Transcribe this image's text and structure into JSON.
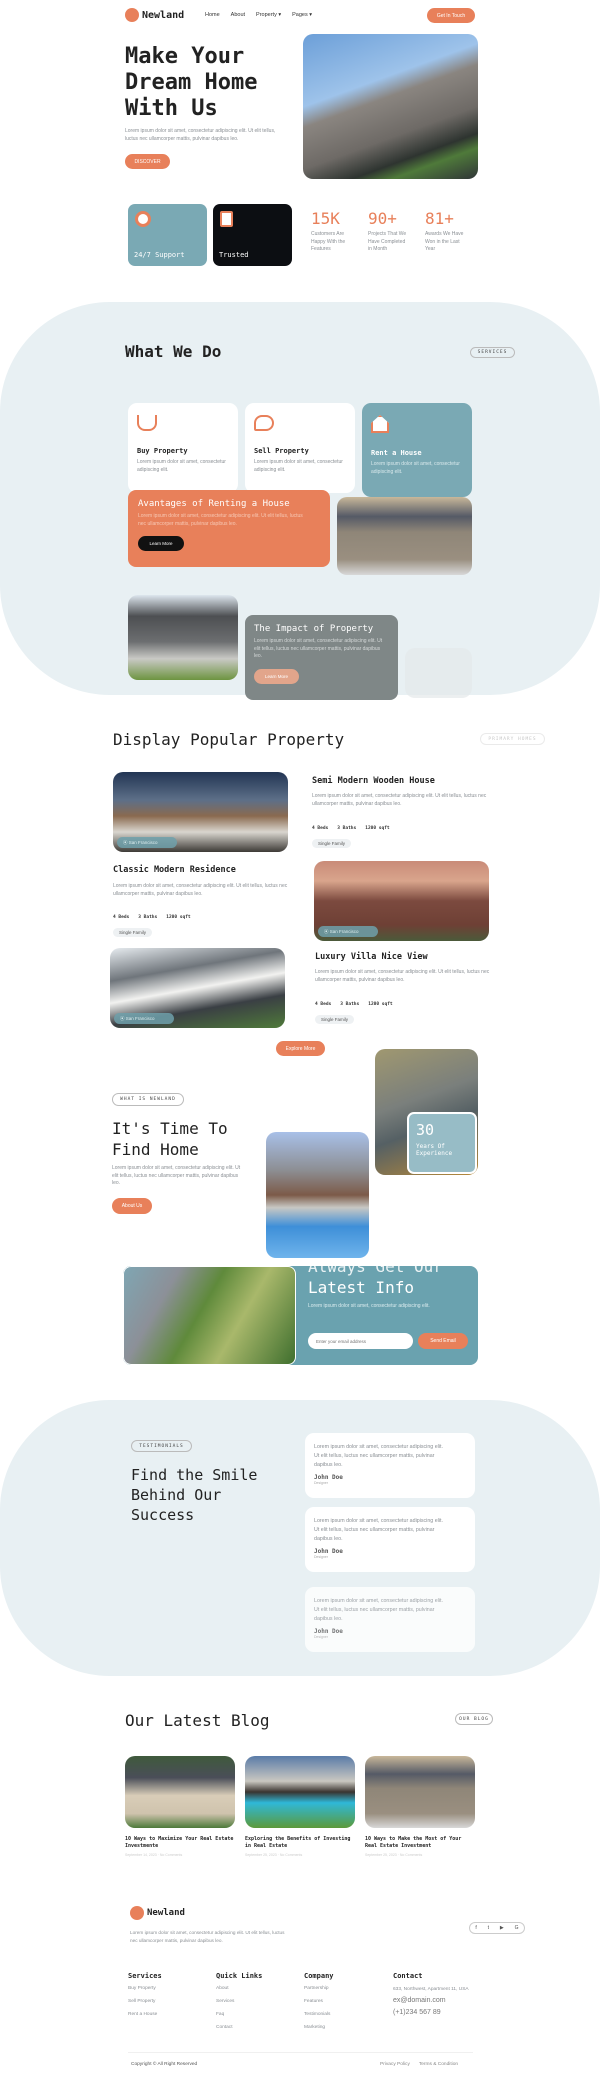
{
  "colors": {
    "accent": "#e8805a",
    "teal": "#7aa9b4",
    "band": "#e8f0f3",
    "dark": "#0c0e12"
  },
  "nav": {
    "brand": "Newland",
    "links": [
      "Home",
      "About",
      "Property",
      "Pages"
    ],
    "cta": "Get In Touch"
  },
  "hero": {
    "title": "Make Your Dream Home With Us",
    "text": "Lorem ipsum dolor sit amet, consectetur adipiscing elit. Ut elit tellus, luctus nec ullamcorper mattis, pulvinar dapibus leo.",
    "button": "Discover"
  },
  "features": [
    {
      "label": "24/7 Support",
      "icon": "support-house-icon"
    },
    {
      "label": "Trusted",
      "icon": "document-house-icon"
    }
  ],
  "stats": [
    {
      "value": "15K",
      "label": "Customers Are Happy With the Features"
    },
    {
      "value": "90+",
      "label": "Projects That We Have Completed in Month"
    },
    {
      "value": "81+",
      "label": "Awards We Have Won in the Last Year"
    }
  ],
  "services": {
    "title": "What We Do",
    "badge": "SERVICES",
    "cards": [
      {
        "title": "Buy Property",
        "text": "Lorem ipsum dolor sit amet, consectetur adipiscing elit.",
        "icon": "key-hand-icon"
      },
      {
        "title": "Sell Property",
        "text": "Lorem ipsum dolor sit amet, consectetur adipiscing elit.",
        "icon": "house-hand-icon"
      },
      {
        "title": "Rent a House",
        "text": "Lorem ipsum dolor sit amet, consectetur adipiscing elit.",
        "icon": "house-icon"
      }
    ],
    "advantages": {
      "title": "Avantages of Renting a House",
      "text": "Lorem ipsum dolor sit amet, consectetur adipiscing elit. Ut elit tellus, luctus nec ullamcorper mattis, pulvinar dapibus leo.",
      "button": "Learn More"
    },
    "impact": {
      "title": "The Impact of Property",
      "text": "Lorem ipsum dolor sit amet, consectetur adipiscing elit. Ut elit tellus, luctus nec ullamcorper mattis, pulvinar dapibus leo.",
      "button": "Learn More"
    }
  },
  "popular": {
    "title": "Display Popular Property",
    "badge": "PRIMARY HOMES",
    "button": "Explore More",
    "properties": [
      {
        "title": "Semi Modern Wooden House",
        "text": "Lorem ipsum dolor sit amet, consectetur adipiscing elit. Ut elit tellus, luctus nec ullamcorper mattis, pulvinar dapibus leo.",
        "beds": "4 Beds",
        "baths": "3 Baths",
        "area": "1200 sqft",
        "tag": "Single Family",
        "location": "San Francisco"
      },
      {
        "title": "Classic Modern Residence",
        "text": "Lorem ipsum dolor sit amet, consectetur adipiscing elit. Ut elit tellus, luctus nec ullamcorper mattis, pulvinar dapibus leo.",
        "beds": "4 Beds",
        "baths": "3 Baths",
        "area": "1200 sqft",
        "tag": "Single Family",
        "location": "San Francisco"
      },
      {
        "title": "Luxury Villa Nice View",
        "text": "Lorem ipsum dolor sit amet, consectetur adipiscing elit. Ut elit tellus, luctus nec ullamcorper mattis, pulvinar dapibus leo.",
        "beds": "4 Beds",
        "baths": "3 Baths",
        "area": "1200 sqft",
        "tag": "Single Family",
        "location": "San Francisco"
      }
    ]
  },
  "about": {
    "badge": "WHAT IS NEWLAND",
    "title": "It's Time To Find Home",
    "text": "Lorem ipsum dolor sit amet, consectetur adipiscing elit. Ut elit tellus, luctus nec ullamcorper mattis, pulvinar dapibus leo.",
    "button": "About Us",
    "years": "30",
    "years_label": "Years Of Experience"
  },
  "newsletter": {
    "title_top": "Always Get Our",
    "title": "Latest Info",
    "text": "Lorem ipsum dolor sit amet, consectetur adipiscing elit.",
    "placeholder": "Enter your email address",
    "button": "Send Email"
  },
  "testimonials": {
    "badge": "TESTIMONIALS",
    "title": "Find the Smile Behind Our Success",
    "items": [
      {
        "text": "Lorem ipsum dolor sit amet, consectetur adipiscing elit. Ut elit tellus, luctus nec ullamcorper mattis, pulvinar dapibus leo.",
        "name": "John Doe",
        "role": "Designer"
      },
      {
        "text": "Lorem ipsum dolor sit amet, consectetur adipiscing elit. Ut elit tellus, luctus nec ullamcorper mattis, pulvinar dapibus leo.",
        "name": "John Doe",
        "role": "Designer"
      },
      {
        "text": "Lorem ipsum dolor sit amet, consectetur adipiscing elit. Ut elit tellus, luctus nec ullamcorper mattis, pulvinar dapibus leo.",
        "name": "John Doe",
        "role": "Designer"
      }
    ]
  },
  "blog": {
    "title": "Our Latest Blog",
    "badge": "OUR BLOG",
    "posts": [
      {
        "title": "10 Ways to Maximize Your Real Estate Investmente",
        "meta": "September 14, 2023 · No Comments"
      },
      {
        "title": "Exploring the Benefits of Investing in Real Estate",
        "meta": "September 25, 2023 · No Comments"
      },
      {
        "title": "10 Ways to Make the Most of Your Real Estate Investment",
        "meta": "September 25, 2023 · No Comments"
      }
    ]
  },
  "footer": {
    "brand": "Newland",
    "text": "Lorem ipsum dolor sit amet, consectetur adipiscing elit. Ut elit tellus, luctus nec ullamcorper mattis, pulvinar dapibus leo.",
    "social": [
      "f",
      "t",
      "▶",
      "G"
    ],
    "columns": [
      {
        "title": "Services",
        "links": [
          "Buy Property",
          "Sell Property",
          "Rent a House"
        ]
      },
      {
        "title": "Quick Links",
        "links": [
          "About",
          "Services",
          "Faq",
          "Contact"
        ]
      },
      {
        "title": "Company",
        "links": [
          "Partnership",
          "Features",
          "Testimonials",
          "Marketing"
        ]
      }
    ],
    "contact": {
      "title": "Contact",
      "address": "633, Northwest, Apartment 11, USA",
      "email": "ex@domain.com",
      "phone": "(+1)234 567 89"
    },
    "copyright": "Copyright © All Right Reserved",
    "legal": [
      "Privacy Policy",
      "Terms & Condition"
    ]
  }
}
